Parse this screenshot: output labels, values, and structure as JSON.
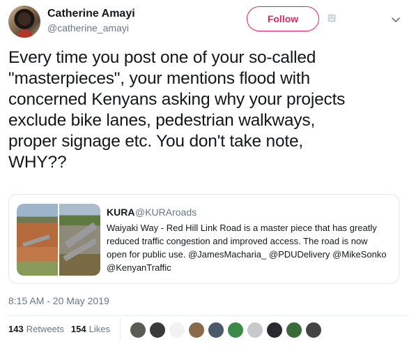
{
  "author": {
    "name": "Catherine Amayi",
    "handle": "@catherine_amayi"
  },
  "actions": {
    "follow_label": "Follow"
  },
  "tweet": {
    "lines": [
      "Every time you post one of your so-called",
      "\"masterpieces\", your mentions flood with",
      "concerned Kenyans asking why your projects",
      "exclude bike lanes, pedestrian walkways,",
      "proper signage etc. You don't take note,",
      "WHY??"
    ],
    "timestamp": "8:15 AM - 20 May 2019"
  },
  "quoted_tweet": {
    "name": "KURA",
    "handle": "@KURAroads",
    "lines": [
      "Waiyaki Way - Red Hill Link Road is a master piece that has greatly",
      "reduced traffic congestion and improved access. The road is now",
      "open for public use. @JamesMacharia_ @PDUDelivery @MikeSonko",
      "@KenyanTraffic"
    ]
  },
  "stats": {
    "retweets_count": "143",
    "retweets_label": "Retweets",
    "likes_count": "154",
    "likes_label": "Likes"
  },
  "likers": [
    {
      "color": "#5b5a55"
    },
    {
      "color": "#3a3a3a"
    },
    {
      "color": "#f2f2f2"
    },
    {
      "color": "#8a6a4a"
    },
    {
      "color": "#4a5a6a"
    },
    {
      "color": "#3c8a4a"
    },
    {
      "color": "#c7c9cc"
    },
    {
      "color": "#2a2a30"
    },
    {
      "color": "#3a6a3a"
    },
    {
      "color": "#444444"
    }
  ],
  "colors": {
    "accent": "#e0245e",
    "secondary_text": "#657786",
    "primary_text": "#14171a"
  }
}
